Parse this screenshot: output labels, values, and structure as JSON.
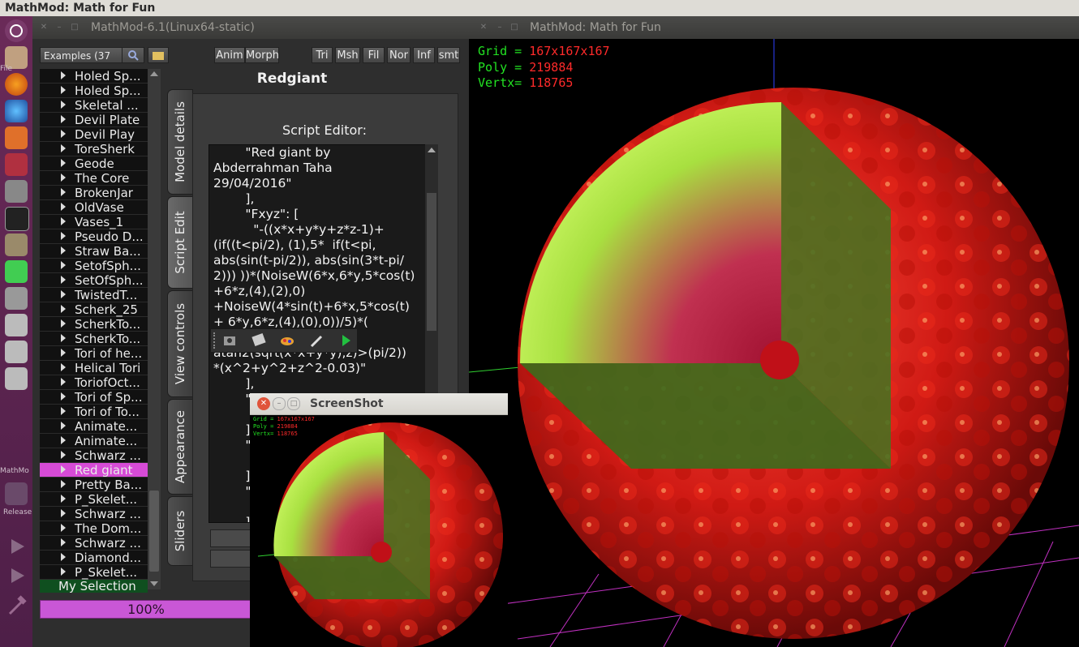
{
  "topbar": {
    "title": "MathMod: Math for Fun"
  },
  "launcher": {
    "labels": [
      "File",
      "MathMo",
      "Release"
    ],
    "icons": [
      "ubuntu-dash-icon",
      "files-icon",
      "firefox-icon",
      "app-icon",
      "software-center-icon",
      "settings-icon",
      "camera-icon",
      "terminal-icon",
      "gimp-icon",
      "qt-icon",
      "help-icon",
      "drive-icon",
      "drive-icon-2",
      "drive-icon-3",
      "display-icon",
      "play-icon",
      "play-icon-2",
      "hammer-icon"
    ]
  },
  "left_window": {
    "title": "MathMod-6.1(Linux64-static)",
    "examples_combo": "Examples (37",
    "buttons": {
      "anim": "Anim",
      "morph": "Morph",
      "tri": "Tri",
      "msh": "Msh",
      "fil": "Fil",
      "nor": "Nor",
      "inf": "Inf",
      "smt": "smt"
    },
    "model_title": "Redgiant",
    "tabs": [
      "Model details",
      "Script Edit",
      "View controls",
      "Appearance",
      "Sliders"
    ],
    "script_editor_label": "Script Editor:",
    "script_text": "        \"Red giant by\nAbderrahman Taha\n29/04/2016\"\n        ],\n        \"Fxyz\": [\n          \"-((x*x+y*y+z*z-1)+\n(if((t<pi/2), (1),5*  if(t<pi,\nabs(sin(t-pi/2)), abs(sin(3*t-pi/\n2))) ))*(NoiseW(6*x,6*y,5*cos(t)\n+6*z,(4),(2),0)\n+NoiseW(4*sin(t)+6*x,5*cos(t)\n+ 6*y,6*z,(4),(0),0))/5)*(\n\natan2(sqrt(x*x+y*y),z)>(pi/2))\n*(x^2+y^2+z^2-0.03)\"\n        ],\n        \"\n\n        ]\n        \"\n\n        ]\n        \"\n\n        ]",
    "list_items": [
      "Holed Sp...",
      "Holed Sp...",
      "Skeletal ...",
      "Devil Plate",
      "Devil Play",
      "ToreSherk",
      "Geode",
      "The Core",
      "BrokenJar",
      "OldVase",
      "Vases_1",
      "Pseudo D...",
      "Straw Ba...",
      "SetofSph...",
      "SetOfSph...",
      "TwistedT...",
      "Scherk_25",
      "ScherkTo...",
      "ScherkTo...",
      "Tori of he...",
      "Helical Tori",
      "ToriofOct...",
      "Tori of Sp...",
      "Tori of To...",
      "Animate...",
      "Animate...",
      "Schwarz ...",
      "Red giant",
      "Pretty Ba...",
      "P_Skelet...",
      "Schwarz ...",
      "The Dom...",
      "Schwarz ...",
      "Diamond...",
      "P_Skelet..."
    ],
    "selected_index": 27,
    "selection_label": "My Selection",
    "progress": {
      "text": "100%",
      "value": 1.0
    }
  },
  "right_window": {
    "title": "MathMod: Math for Fun",
    "hud": [
      {
        "label": "Grid = ",
        "value": "167x167x167"
      },
      {
        "label": "Poly = ",
        "value": "219884"
      },
      {
        "label": "Vertx= ",
        "value": "118765"
      }
    ]
  },
  "screenshot_window": {
    "title": "ScreenShot",
    "hud": [
      {
        "label": "Grid = ",
        "value": "167x167x167"
      },
      {
        "label": "Poly = ",
        "value": "219884"
      },
      {
        "label": "Vertx= ",
        "value": "118765"
      }
    ]
  },
  "colors": {
    "accent": "#d64bd6",
    "hud_label": "#22e322",
    "hud_value": "#ff2a2a",
    "launcher": "#5c2352"
  }
}
